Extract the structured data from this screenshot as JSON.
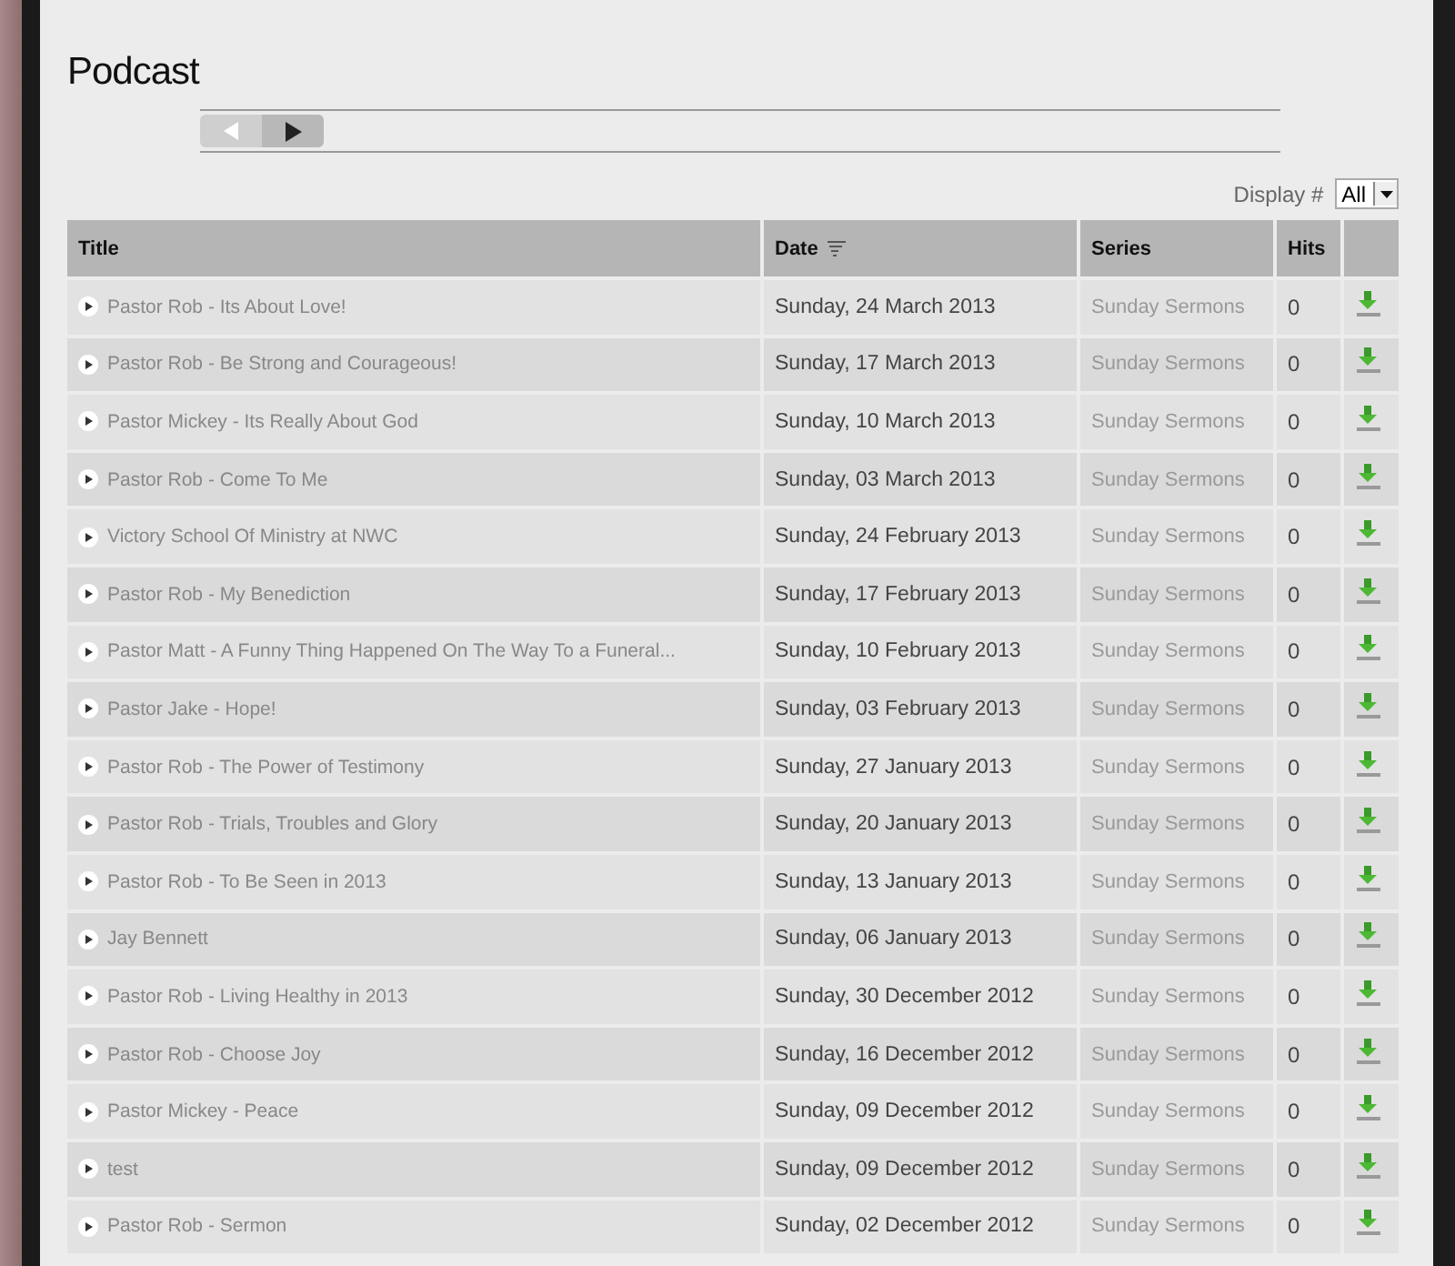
{
  "title": "Podcast",
  "display": {
    "label": "Display #",
    "value": "All"
  },
  "columns": [
    "Title",
    "Date",
    "Series",
    "Hits"
  ],
  "rows": [
    {
      "title": "Pastor Rob - Its About Love!",
      "date": "Sunday, 24 March 2013",
      "series": "Sunday Sermons",
      "hits": "0"
    },
    {
      "title": "Pastor Rob - Be Strong and Courageous!",
      "date": "Sunday, 17 March 2013",
      "series": "Sunday Sermons",
      "hits": "0"
    },
    {
      "title": "Pastor Mickey - Its Really About God",
      "date": "Sunday, 10 March 2013",
      "series": "Sunday Sermons",
      "hits": "0"
    },
    {
      "title": "Pastor Rob - Come To Me",
      "date": "Sunday, 03 March 2013",
      "series": "Sunday Sermons",
      "hits": "0"
    },
    {
      "title": "Victory School Of Ministry at NWC",
      "date": "Sunday, 24 February 2013",
      "series": "Sunday Sermons",
      "hits": "0"
    },
    {
      "title": "Pastor Rob - My Benediction",
      "date": "Sunday, 17 February 2013",
      "series": "Sunday Sermons",
      "hits": "0"
    },
    {
      "title": "Pastor Matt - A Funny Thing Happened On The Way To a Funeral...",
      "date": "Sunday, 10 February 2013",
      "series": "Sunday Sermons",
      "hits": "0"
    },
    {
      "title": "Pastor Jake - Hope!",
      "date": "Sunday, 03 February 2013",
      "series": "Sunday Sermons",
      "hits": "0"
    },
    {
      "title": "Pastor Rob - The Power of Testimony",
      "date": "Sunday, 27 January 2013",
      "series": "Sunday Sermons",
      "hits": "0"
    },
    {
      "title": "Pastor Rob - Trials, Troubles and Glory",
      "date": "Sunday, 20 January 2013",
      "series": "Sunday Sermons",
      "hits": "0"
    },
    {
      "title": "Pastor Rob - To Be Seen in 2013",
      "date": "Sunday, 13 January 2013",
      "series": "Sunday Sermons",
      "hits": "0"
    },
    {
      "title": "Jay Bennett",
      "date": "Sunday, 06 January 2013",
      "series": "Sunday Sermons",
      "hits": "0"
    },
    {
      "title": "Pastor Rob - Living Healthy in 2013",
      "date": "Sunday, 30 December 2012",
      "series": "Sunday Sermons",
      "hits": "0"
    },
    {
      "title": "Pastor Rob - Choose Joy",
      "date": "Sunday, 16 December 2012",
      "series": "Sunday Sermons",
      "hits": "0"
    },
    {
      "title": "Pastor Mickey - Peace",
      "date": "Sunday, 09 December 2012",
      "series": "Sunday Sermons",
      "hits": "0"
    },
    {
      "title": "test",
      "date": "Sunday, 09 December 2012",
      "series": "Sunday Sermons",
      "hits": "0"
    },
    {
      "title": "Pastor Rob - Sermon",
      "date": "Sunday, 02 December 2012",
      "series": "Sunday Sermons",
      "hits": "0"
    }
  ]
}
